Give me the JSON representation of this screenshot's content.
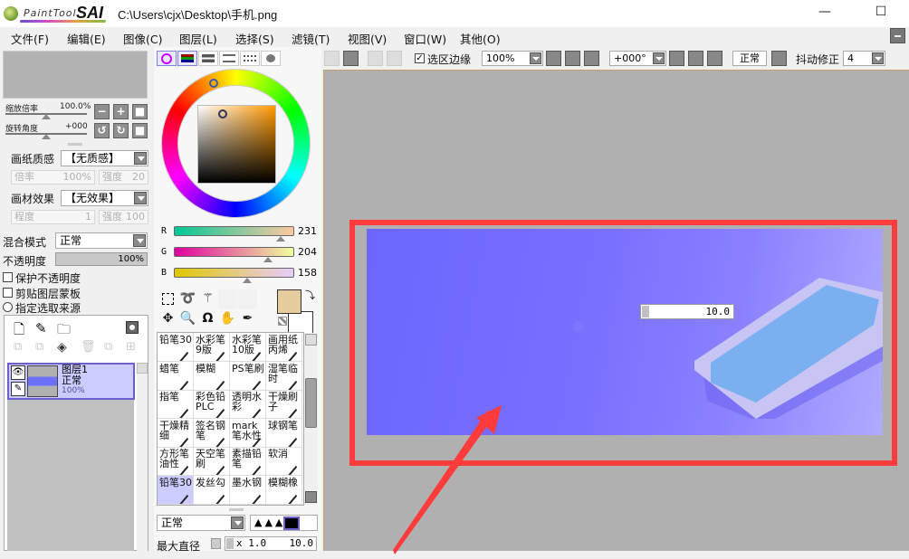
{
  "app": {
    "name_part1": "PaintTool",
    "name_part2": "SAI",
    "window_title": "C:\\Users\\cjx\\Desktop\\手机.png",
    "minimize": "—",
    "maximize": "☐"
  },
  "menu": [
    "文件(F)",
    "编辑(E)",
    "图像(C)",
    "图层(L)",
    "选择(S)",
    "滤镜(T)",
    "视图(V)",
    "窗口(W)",
    "其他(O)"
  ],
  "navigator": {
    "zoom_label": "缩放倍率",
    "zoom_value": "100.0%",
    "rotate_label": "旋转角度",
    "rotate_value": "+000"
  },
  "paper": {
    "texture_label": "画纸质感",
    "texture_value": "【无质感】",
    "texture_scale_label": "倍率",
    "texture_scale_value": "100%",
    "texture_strength_label": "强度",
    "texture_strength_value": "20",
    "effect_label": "画材效果",
    "effect_value": "【无效果】",
    "effect_degree_label": "程度",
    "effect_degree_value": "1",
    "effect_strength_label": "强度",
    "effect_strength_value": "100"
  },
  "layer_props": {
    "blend_label": "混合模式",
    "blend_value": "正常",
    "opacity_label": "不透明度",
    "opacity_value": "100%",
    "protect_opacity": "保护不透明度",
    "clip_mask": "剪贴图层蒙板",
    "selection_source": "指定选取来源"
  },
  "layers": [
    {
      "name": "图层1",
      "mode": "正常",
      "opacity": "100%"
    }
  ],
  "color": {
    "r_label": "R",
    "r": "231",
    "g_label": "G",
    "g": "204",
    "b_label": "B",
    "b": "158",
    "primary": "#e7cc9e",
    "secondary": "#ffffff"
  },
  "brushes": [
    {
      "name": "铅笔30",
      "selected": false
    },
    {
      "name": "水彩笔9版"
    },
    {
      "name": "水彩笔10版"
    },
    {
      "name": "画用纸丙烯"
    },
    {
      "name": "蜡笔"
    },
    {
      "name": "模糊"
    },
    {
      "name": "PS笔刷"
    },
    {
      "name": "湿笔临时"
    },
    {
      "name": "指笔"
    },
    {
      "name": "彩色铅PLC"
    },
    {
      "name": "透明水彩"
    },
    {
      "name": "干燥刷子"
    },
    {
      "name": "干燥精细"
    },
    {
      "name": "签名钢笔"
    },
    {
      "name": "mark笔水性"
    },
    {
      "name": "球钢笔"
    },
    {
      "name": "方形笔油性"
    },
    {
      "name": "天空笔刷"
    },
    {
      "name": "素描铅笔"
    },
    {
      "name": "软消"
    },
    {
      "name": "铅笔30",
      "selected": true
    },
    {
      "name": "发丝勾"
    },
    {
      "name": "墨水钢"
    },
    {
      "name": "模糊橡"
    }
  ],
  "brush_settings": {
    "mode": "正常",
    "max_size_label": "最大直径",
    "size_multiplier": "x 1.0",
    "size_value": "10.0"
  },
  "toolbar": {
    "selection_edge_label": "选区边缘",
    "selection_edge_checked": true,
    "zoom": "100%",
    "rotation": "+000°",
    "blend": "正常",
    "stabilizer_label": "抖动修正",
    "stabilizer_value": "4"
  },
  "canvas": {
    "brush_size_popup": "10.0"
  }
}
